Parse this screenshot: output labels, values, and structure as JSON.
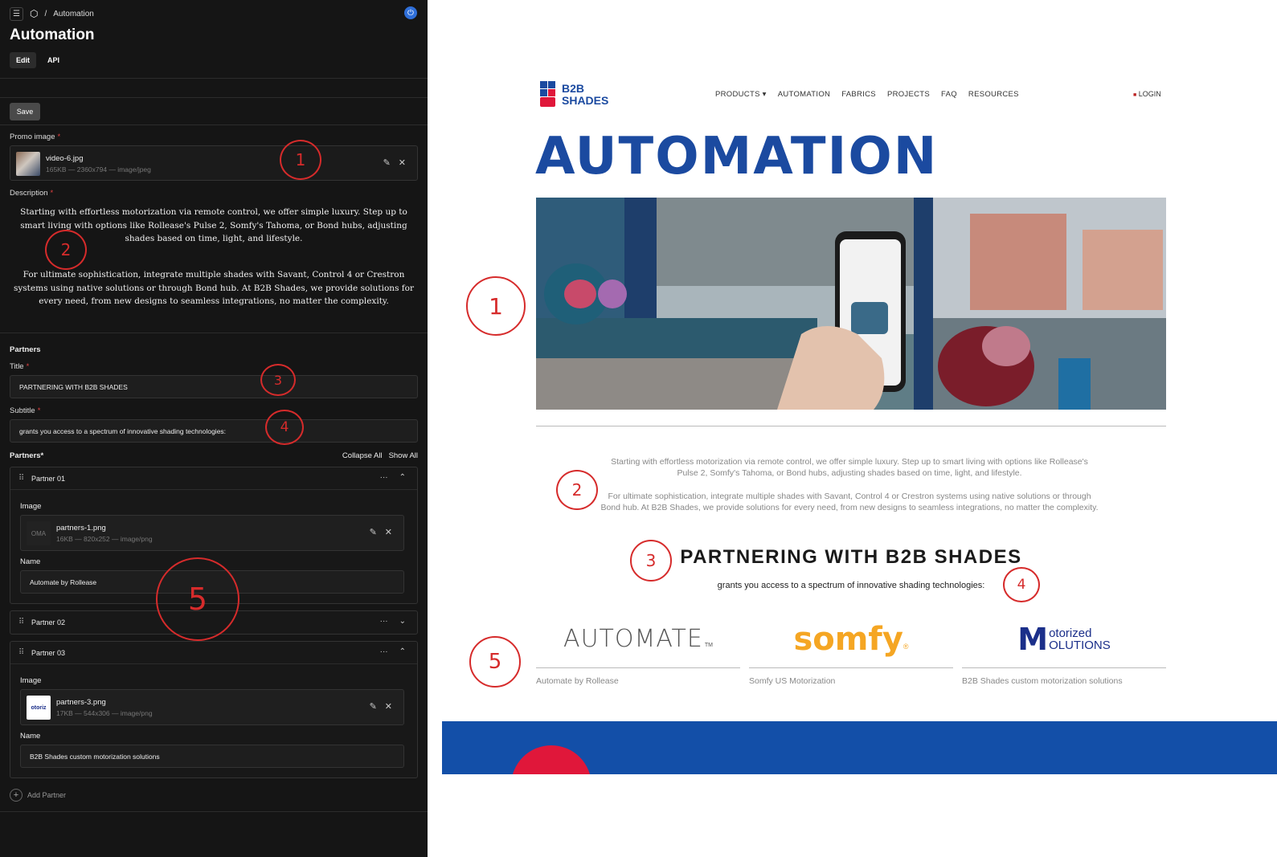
{
  "cms": {
    "breadcrumb": "Automation",
    "separator": "/",
    "title": "Automation",
    "tabs": [
      {
        "label": "Edit"
      },
      {
        "label": "API"
      }
    ],
    "save_label": "Save",
    "promo": {
      "label": "Promo image",
      "filename": "video-6.jpg",
      "meta": "165KB — 2360x794 — image/jpeg"
    },
    "description": {
      "label": "Description",
      "p1": "Starting with effortless motorization via remote control, we offer simple luxury. Step up to smart living with options like Rollease's Pulse 2, Somfy's Tahoma, or Bond hubs, adjusting shades based on time, light, and lifestyle.",
      "p2": "For ultimate sophistication, integrate multiple shades with Savant, Control 4 or Crestron systems using native solutions or through Bond hub. At B2B Shades, we provide solutions for every need, from new designs to seamless integrations, no matter the complexity."
    },
    "partners_section": "Partners",
    "title_field": {
      "label": "Title",
      "value": "PARTNERING WITH B2B SHADES"
    },
    "subtitle_field": {
      "label": "Subtitle",
      "value": "grants you access to a spectrum of innovative shading technologies:"
    },
    "partners_label": "Partners*",
    "collapse_all": "Collapse All",
    "show_all": "Show All",
    "image_label": "Image",
    "name_label": "Name",
    "partners": [
      {
        "header": "Partner 01",
        "filename": "partners-1.png",
        "meta": "16KB — 820x252 — image/png",
        "name": "Automate by Rollease",
        "thumb_text": "OMA"
      },
      {
        "header": "Partner 02"
      },
      {
        "header": "Partner 03",
        "filename": "partners-3.png",
        "meta": "17KB — 544x306 — image/png",
        "name": "B2B Shades custom motorization solutions",
        "thumb_text": "otoriz"
      }
    ],
    "add_partner": "Add Partner"
  },
  "site": {
    "brand_line1": "B2B",
    "brand_line2": "SHADES",
    "nav": [
      {
        "label": "PRODUCTS ▾"
      },
      {
        "label": "AUTOMATION"
      },
      {
        "label": "FABRICS"
      },
      {
        "label": "PROJECTS"
      },
      {
        "label": "FAQ"
      },
      {
        "label": "RESOURCES"
      }
    ],
    "login": "LOGIN",
    "hero_title": "AUTOMATION",
    "p1": "Starting with effortless motorization via remote control, we offer simple luxury. Step up to smart living with options like Rollease's Pulse 2, Somfy's Tahoma, or Bond hubs, adjusting shades based on time, light, and lifestyle.",
    "p2": "For ultimate sophistication, integrate multiple shades with Savant, Control 4 or Crestron systems using native solutions or through Bond hub. At B2B Shades, we provide solutions for every need, from new designs to seamless integrations, no matter the complexity.",
    "partners_title": "PARTNERING WITH B2B SHADES",
    "partners_subtitle": "grants you access to a spectrum of innovative shading technologies:",
    "partners": [
      {
        "logo": "AUTOMATE",
        "logo_tm": "TM",
        "label": "Automate by Rollease"
      },
      {
        "logo": "somfy",
        "logo_r": "®",
        "label": "Somfy US Motorization"
      },
      {
        "logo1": "otorized",
        "logo2": "OLUTIONS",
        "label": "B2B Shades custom motorization solutions"
      }
    ]
  },
  "annotations": {
    "n1": "1",
    "n2": "2",
    "n3": "3",
    "n4": "4",
    "n5": "5"
  },
  "colors": {
    "brand_blue": "#1b4aa0",
    "brand_red": "#e0173a",
    "annotation_red": "#d62b2b"
  }
}
